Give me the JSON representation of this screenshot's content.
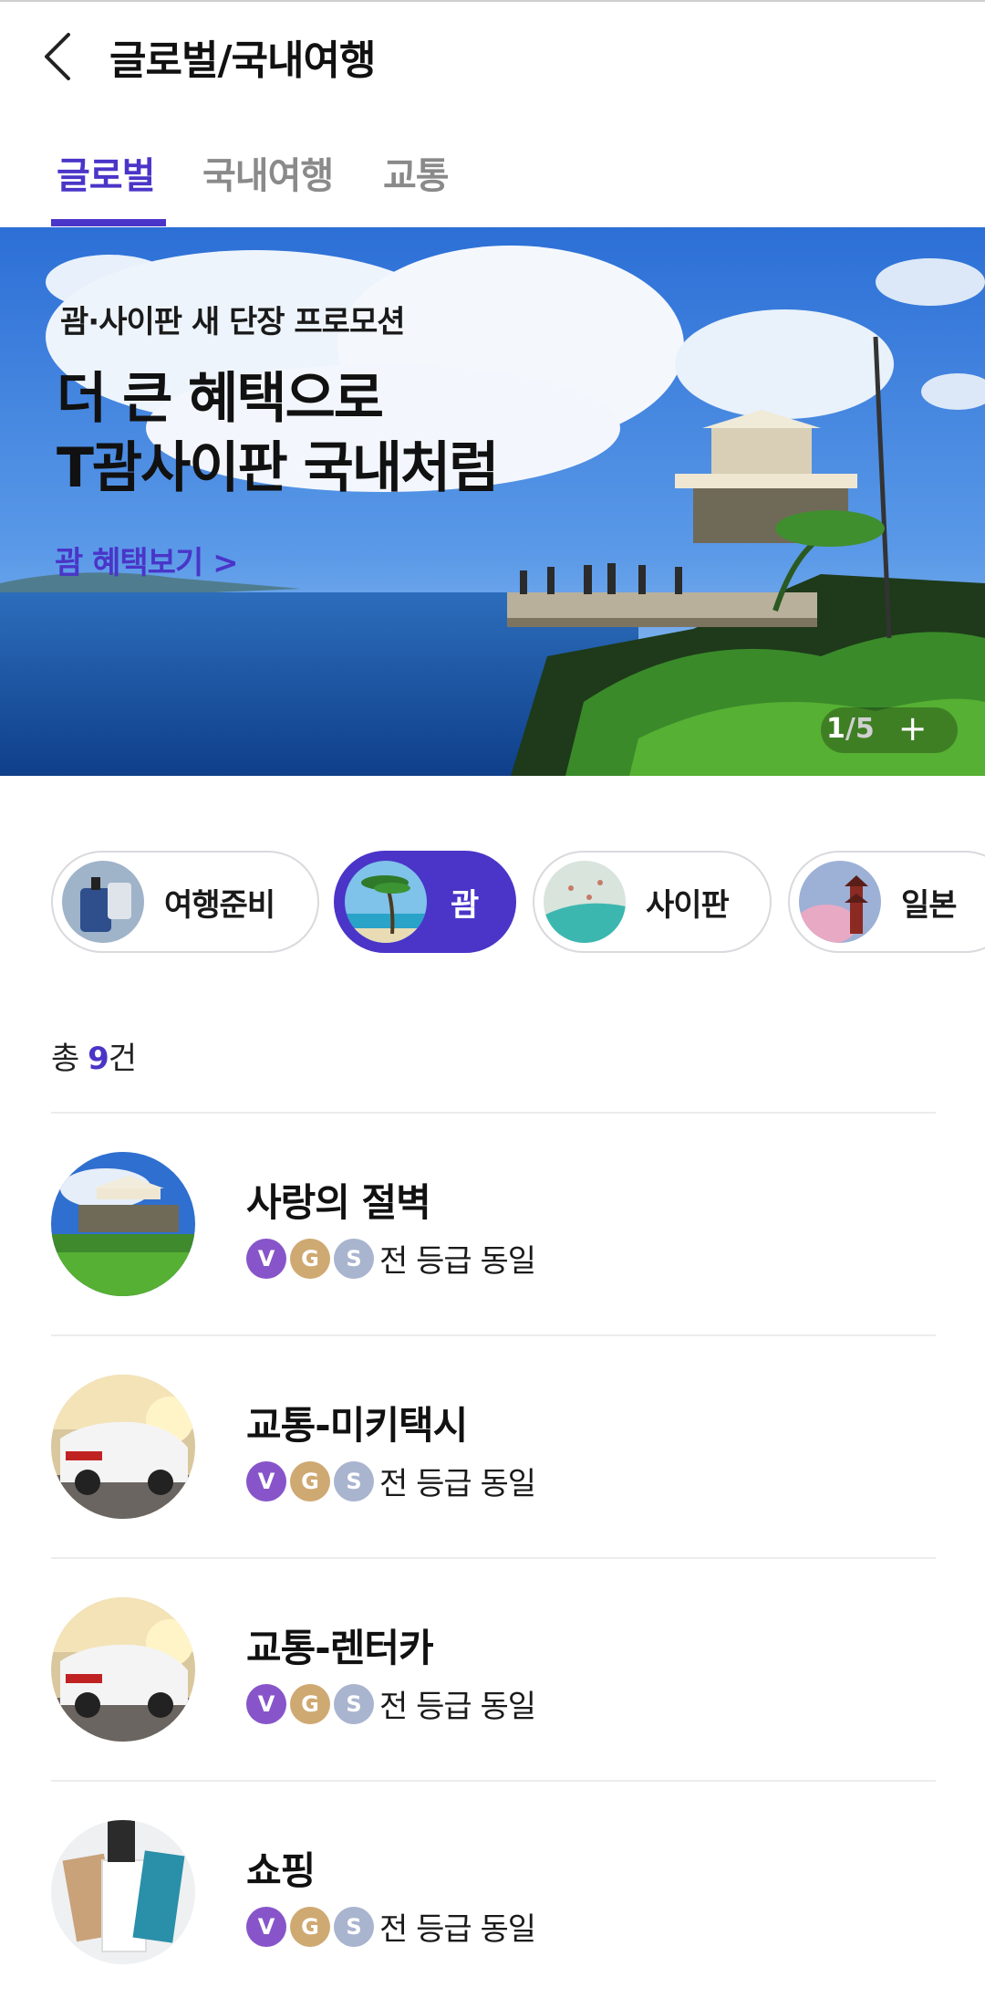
{
  "header": {
    "title": "글로벌/국내여행"
  },
  "tabs": [
    {
      "label": "글로벌",
      "active": true
    },
    {
      "label": "국내여행",
      "active": false
    },
    {
      "label": "교통",
      "active": false
    }
  ],
  "banner": {
    "subtitle": "괌·사이판 새 단장 프로모션",
    "title_line1": "더 큰 혜택으로",
    "title_line2": "T괌사이판 국내처럼",
    "link": "괌 혜택보기 >",
    "pager_current": "1",
    "pager_total": "/5",
    "pager_plus": "+"
  },
  "chips": [
    {
      "label": "여행준비",
      "active": false
    },
    {
      "label": "괌",
      "active": true
    },
    {
      "label": "사이판",
      "active": false
    },
    {
      "label": "일본",
      "active": false
    }
  ],
  "count": {
    "prefix": "총 ",
    "number": "9",
    "suffix": "건"
  },
  "items": [
    {
      "title": "사랑의 절벽",
      "grade_text": "전 등급 동일"
    },
    {
      "title": "교통-미키택시",
      "grade_text": "전 등급 동일"
    },
    {
      "title": "교통-렌터카",
      "grade_text": "전 등급 동일"
    },
    {
      "title": "쇼핑",
      "grade_text": "전 등급 동일"
    }
  ],
  "badges": {
    "v": "V",
    "g": "G",
    "s": "S"
  },
  "colors": {
    "accent": "#4a35c8",
    "badge_v": "#8755c9",
    "badge_g": "#cfa972",
    "badge_s": "#a9b4cf"
  },
  "icons": {
    "back": "chevron-left-icon",
    "plus": "plus-icon"
  }
}
